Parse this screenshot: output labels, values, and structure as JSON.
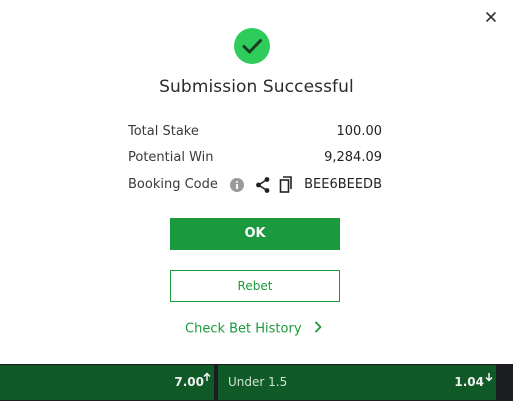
{
  "dialog": {
    "title": "Submission Successful",
    "rows": [
      {
        "label": "Total Stake",
        "value": "100.00"
      },
      {
        "label": "Potential Win",
        "value": "9,284.09"
      },
      {
        "label": "Booking Code",
        "value": "BEE6BEEDB"
      }
    ],
    "ok_label": "OK",
    "rebet_label": "Rebet",
    "history_label": "Check Bet History",
    "colors": {
      "accent": "#1a9a3c",
      "success": "#2ecc5b"
    }
  },
  "bottom_bar": {
    "cells": [
      {
        "selection": "",
        "odd": "7.00",
        "trend": "up"
      },
      {
        "selection": "Under 1.5",
        "odd": "1.04",
        "trend": "down"
      }
    ],
    "colors": {
      "cell_bg": "#0f5a26"
    }
  }
}
